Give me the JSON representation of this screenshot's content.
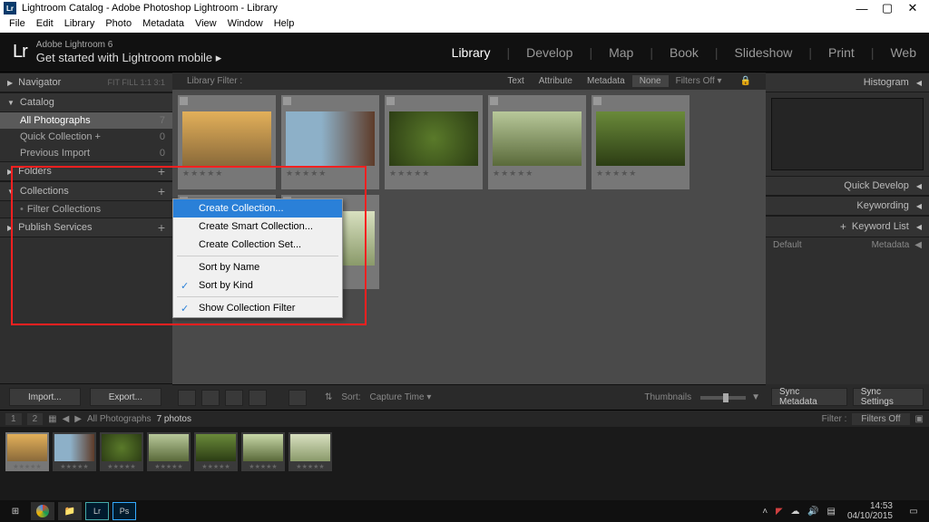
{
  "window": {
    "title": "Lightroom Catalog - Adobe Photoshop Lightroom - Library",
    "menu": [
      "File",
      "Edit",
      "Library",
      "Photo",
      "Metadata",
      "View",
      "Window",
      "Help"
    ],
    "controls": {
      "min": "—",
      "max": "▢",
      "close": "✕"
    }
  },
  "app": {
    "brand_small": "Adobe Lightroom 6",
    "tagline": "Get started with Lightroom mobile  ▸",
    "modules": [
      "Library",
      "Develop",
      "Map",
      "Book",
      "Slideshow",
      "Print",
      "Web"
    ],
    "active_module": "Library"
  },
  "left": {
    "navigator": {
      "title": "Navigator",
      "dim": "FIT   FILL   1:1   3:1"
    },
    "catalog": {
      "title": "Catalog",
      "rows": [
        {
          "label": "All Photographs",
          "count": "7",
          "selected": true
        },
        {
          "label": "Quick Collection  +",
          "count": "0"
        },
        {
          "label": "Previous Import",
          "count": "0"
        }
      ]
    },
    "folders": {
      "title": "Folders"
    },
    "collections": {
      "title": "Collections",
      "rows": [
        {
          "label": "Filter Collections"
        }
      ]
    },
    "publish": {
      "title": "Publish Services"
    },
    "import_btn": "Import...",
    "export_btn": "Export..."
  },
  "center": {
    "filter_label": "Library Filter :",
    "filter_tabs": [
      "Text",
      "Attribute",
      "Metadata",
      "None"
    ],
    "filters_off": "Filters Off ▾",
    "lock": "🔒",
    "stars": "★★★★★",
    "sort_label": "Sort:",
    "sort_field": "Capture Time  ▾",
    "thumbnails": "Thumbnails"
  },
  "right": {
    "histogram": "Histogram",
    "quick_develop": "Quick Develop",
    "keywording": "Keywording",
    "keyword_list": "Keyword List",
    "metadata": "Metadata",
    "default": "Default",
    "sync_metadata": "Sync Metadata",
    "sync_settings": "Sync Settings"
  },
  "context_menu": {
    "items": [
      {
        "label": "Create Collection...",
        "hl": true
      },
      {
        "label": "Create Smart Collection..."
      },
      {
        "label": "Create Collection Set..."
      },
      {
        "sep": true
      },
      {
        "label": "Sort by Name"
      },
      {
        "label": "Sort by Kind",
        "chk": true
      },
      {
        "sep": true
      },
      {
        "label": "Show Collection Filter",
        "chk": true
      }
    ]
  },
  "filmstrip": {
    "path": "All Photographs",
    "count": "7 photos",
    "filter_label": "Filter :",
    "filter_value": "Filters Off"
  },
  "taskbar": {
    "time": "14:53",
    "date": "04/10/2015"
  }
}
